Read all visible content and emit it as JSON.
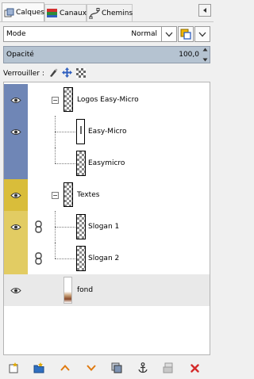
{
  "tabs": [
    {
      "label": "Calques",
      "icon": "layers-icon",
      "active": true
    },
    {
      "label": "Canaux",
      "icon": "channels-icon",
      "active": false
    },
    {
      "label": "Chemins",
      "icon": "paths-icon",
      "active": false
    }
  ],
  "mode": {
    "label": "Mode",
    "value": "Normal"
  },
  "opacity": {
    "label": "Opacité",
    "value": "100,0",
    "percent": 100
  },
  "lock": {
    "label": "Verrouiller :",
    "icons": [
      "lock-pixels-icon",
      "lock-position-icon",
      "lock-alpha-icon"
    ]
  },
  "layers": [
    {
      "name": "Logos Easy-Micro",
      "type": "group",
      "expanded": true,
      "color": "#6f86b6"
    },
    {
      "name": "Easy-Micro",
      "type": "layer",
      "color": "#6f86b6"
    },
    {
      "name": "Easymicro",
      "type": "layer",
      "color": "#6f86b6"
    },
    {
      "name": "Textes",
      "type": "group",
      "expanded": true,
      "color": "#d9bd3a"
    },
    {
      "name": "Slogan 1",
      "type": "layer",
      "linked": true,
      "color": "#e2cc63"
    },
    {
      "name": "Slogan 2",
      "type": "layer",
      "linked": true,
      "color": "#e2cc63"
    },
    {
      "name": "fond",
      "type": "layer",
      "selected": true
    }
  ],
  "toolbar": [
    "new-layer-icon",
    "new-group-icon",
    "raise-layer-icon",
    "lower-layer-icon",
    "duplicate-layer-icon",
    "anchor-layer-icon",
    "merge-down-icon",
    "delete-layer-icon"
  ],
  "colors": {
    "blue_tag": "#6f86b6",
    "yellow_tag": "#d9bd3a",
    "selection": "#e9e9e9",
    "delete": "#d42a2a",
    "arrows": "#e07a10"
  }
}
